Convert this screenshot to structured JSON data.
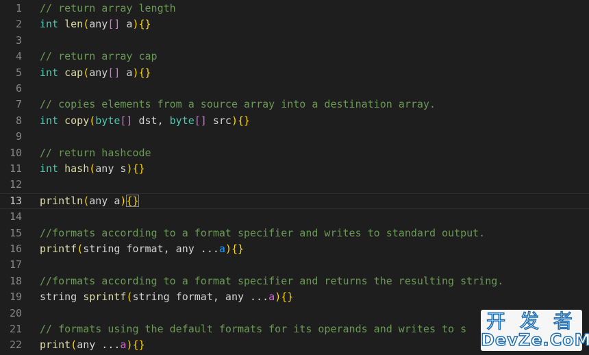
{
  "editor": {
    "current_line": 13,
    "lines": [
      {
        "num": "1",
        "tokens": [
          {
            "t": "// return array length",
            "c": "comment"
          }
        ]
      },
      {
        "num": "2",
        "tokens": [
          {
            "t": "int",
            "c": "kw"
          },
          {
            "t": " ",
            "c": "id"
          },
          {
            "t": "len",
            "c": "fn"
          },
          {
            "t": "(",
            "c": "br1"
          },
          {
            "t": "any",
            "c": "id"
          },
          {
            "t": "[]",
            "c": "br2"
          },
          {
            "t": " a",
            "c": "id"
          },
          {
            "t": ")",
            "c": "br1"
          },
          {
            "t": "{}",
            "c": "br1"
          }
        ]
      },
      {
        "num": "3",
        "tokens": []
      },
      {
        "num": "4",
        "tokens": [
          {
            "t": "// return array cap",
            "c": "comment"
          }
        ]
      },
      {
        "num": "5",
        "tokens": [
          {
            "t": "int",
            "c": "kw"
          },
          {
            "t": " ",
            "c": "id"
          },
          {
            "t": "cap",
            "c": "fn"
          },
          {
            "t": "(",
            "c": "br1"
          },
          {
            "t": "any",
            "c": "id"
          },
          {
            "t": "[]",
            "c": "br2"
          },
          {
            "t": " a",
            "c": "id"
          },
          {
            "t": ")",
            "c": "br1"
          },
          {
            "t": "{}",
            "c": "br1"
          }
        ]
      },
      {
        "num": "6",
        "tokens": []
      },
      {
        "num": "7",
        "tokens": [
          {
            "t": "// copies elements from a source array into a destination array.",
            "c": "comment"
          }
        ]
      },
      {
        "num": "8",
        "tokens": [
          {
            "t": "int",
            "c": "kw"
          },
          {
            "t": " ",
            "c": "id"
          },
          {
            "t": "copy",
            "c": "fn"
          },
          {
            "t": "(",
            "c": "br1"
          },
          {
            "t": "byte",
            "c": "kw"
          },
          {
            "t": "[]",
            "c": "br2"
          },
          {
            "t": " dst, ",
            "c": "id"
          },
          {
            "t": "byte",
            "c": "kw"
          },
          {
            "t": "[]",
            "c": "br2"
          },
          {
            "t": " src",
            "c": "id"
          },
          {
            "t": ")",
            "c": "br1"
          },
          {
            "t": "{}",
            "c": "br1"
          }
        ]
      },
      {
        "num": "9",
        "tokens": []
      },
      {
        "num": "10",
        "tokens": [
          {
            "t": "// return hashcode",
            "c": "comment"
          }
        ]
      },
      {
        "num": "11",
        "tokens": [
          {
            "t": "int",
            "c": "kw"
          },
          {
            "t": " ",
            "c": "id"
          },
          {
            "t": "hash",
            "c": "fn"
          },
          {
            "t": "(",
            "c": "br1"
          },
          {
            "t": "any s",
            "c": "id"
          },
          {
            "t": ")",
            "c": "br1"
          },
          {
            "t": "{}",
            "c": "br1"
          }
        ]
      },
      {
        "num": "12",
        "tokens": []
      },
      {
        "num": "13",
        "tokens": [
          {
            "t": "println",
            "c": "fn"
          },
          {
            "t": "(",
            "c": "br1"
          },
          {
            "t": "any a",
            "c": "id"
          },
          {
            "t": ")",
            "c": "br1"
          },
          {
            "t": "{}",
            "c": "br1",
            "matched": true
          }
        ]
      },
      {
        "num": "14",
        "tokens": []
      },
      {
        "num": "15",
        "tokens": [
          {
            "t": "//formats according to a format specifier and writes to standard output.",
            "c": "comment"
          }
        ]
      },
      {
        "num": "16",
        "tokens": [
          {
            "t": "printf",
            "c": "fn"
          },
          {
            "t": "(",
            "c": "br1"
          },
          {
            "t": "string format, any ...",
            "c": "id"
          },
          {
            "t": "a",
            "c": "br3"
          },
          {
            "t": ")",
            "c": "br1"
          },
          {
            "t": "{}",
            "c": "br1"
          }
        ]
      },
      {
        "num": "17",
        "tokens": []
      },
      {
        "num": "18",
        "tokens": [
          {
            "t": "//formats according to a format specifier and returns the resulting string.",
            "c": "comment"
          }
        ]
      },
      {
        "num": "19",
        "tokens": [
          {
            "t": "string ",
            "c": "id"
          },
          {
            "t": "sprintf",
            "c": "fn"
          },
          {
            "t": "(",
            "c": "br1"
          },
          {
            "t": "string format, any ...",
            "c": "id"
          },
          {
            "t": "a",
            "c": "br2"
          },
          {
            "t": ")",
            "c": "br1"
          },
          {
            "t": "{}",
            "c": "br1"
          }
        ]
      },
      {
        "num": "20",
        "tokens": []
      },
      {
        "num": "21",
        "tokens": [
          {
            "t": "// formats using the default formats for its operands and writes to s",
            "c": "comment"
          }
        ]
      },
      {
        "num": "22",
        "tokens": [
          {
            "t": "print",
            "c": "fn"
          },
          {
            "t": "(",
            "c": "br1"
          },
          {
            "t": "any ...",
            "c": "id"
          },
          {
            "t": "a",
            "c": "br2"
          },
          {
            "t": ")",
            "c": "br1"
          },
          {
            "t": "{}",
            "c": "br1"
          }
        ]
      }
    ]
  },
  "watermark": {
    "line1": "开 发 者",
    "line2": "DevZe.CoM"
  },
  "colors": {
    "background": "#1e1e1e",
    "comment": "#6a9955",
    "keyword": "#4ec9b0",
    "function": "#dcdcaa",
    "bracket_gold": "#ffd700",
    "bracket_purple": "#da70d6",
    "bracket_blue": "#179fff",
    "watermark_blue": "#1f6fb2"
  }
}
